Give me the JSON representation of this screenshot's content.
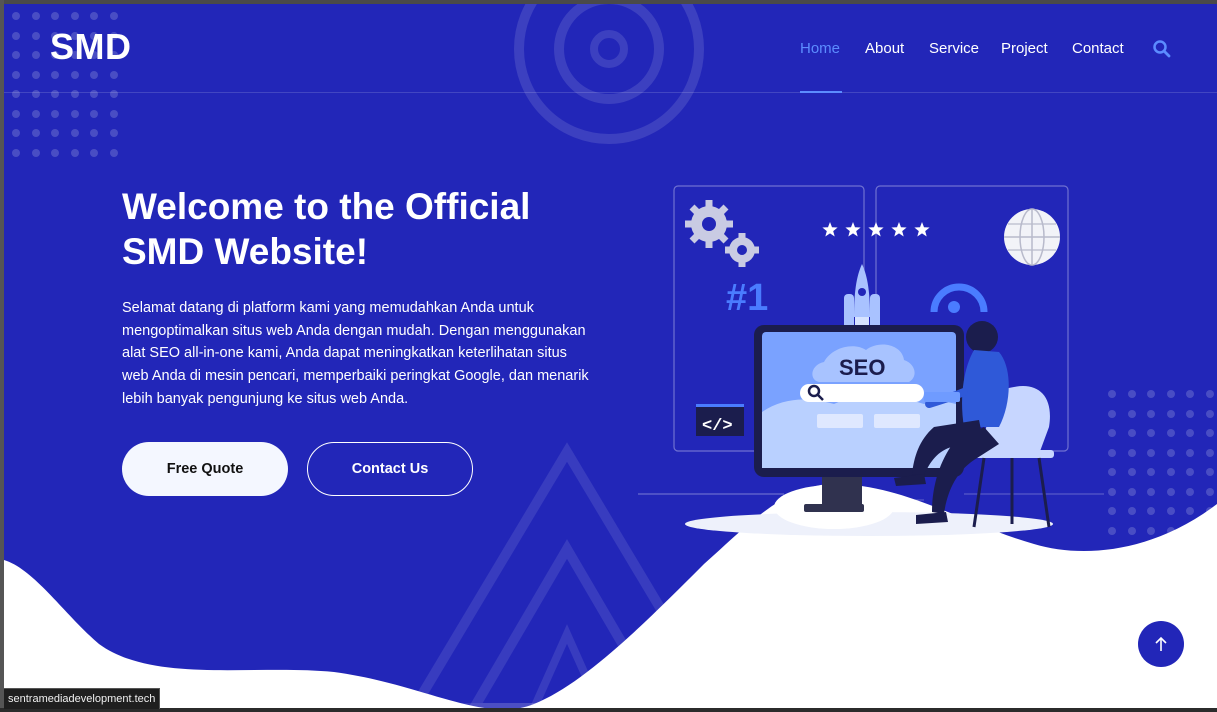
{
  "header": {
    "logo": "SMD",
    "nav": [
      {
        "label": "Home",
        "active": true
      },
      {
        "label": "About",
        "active": false
      },
      {
        "label": "Service",
        "active": false
      },
      {
        "label": "Project",
        "active": false
      },
      {
        "label": "Contact",
        "active": false
      }
    ],
    "search_icon": "search-icon"
  },
  "hero": {
    "title_line1": "Welcome to the Official",
    "title_line2": "SMD Website!",
    "description": "Selamat datang di platform kami yang memudahkan Anda untuk mengoptimalkan situs web Anda dengan mudah. Dengan menggunakan alat SEO all-in-one kami, Anda dapat meningkatkan keterlihatan situs web Anda di mesin pencari, memperbaiki peringkat Google, dan menarik lebih banyak pengunjung ke situs web Anda.",
    "primary_button": "Free Quote",
    "secondary_button": "Contact Us"
  },
  "illustration": {
    "rank_label": "#1",
    "seo_label": "SEO",
    "code_label": "</>",
    "stars": 5
  },
  "scroll_top_icon": "arrow-up-icon",
  "status_bar": {
    "url": "sentramediadevelopment.tech"
  },
  "colors": {
    "background": "#2226b8",
    "accent": "#5c8cff",
    "white": "#ffffff"
  }
}
